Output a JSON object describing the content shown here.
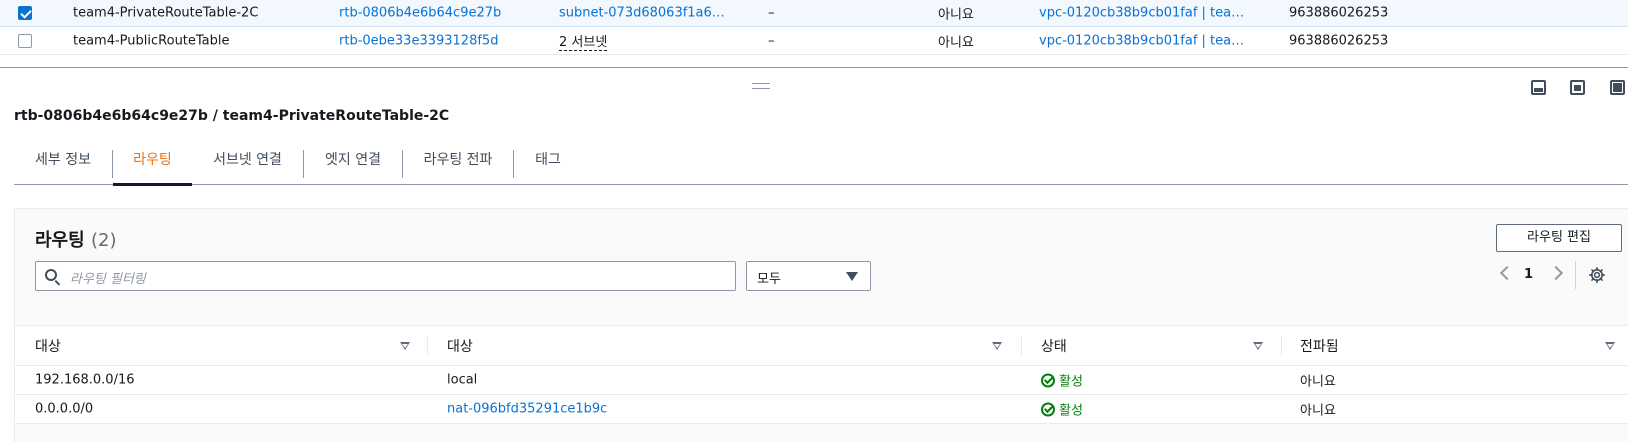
{
  "top_table": {
    "rows": [
      {
        "checked": true,
        "name": "team4-PrivateRouteTable-2C",
        "rtb_id": "rtb-0806b4e6b64c9e27b",
        "subnet": "subnet-073d68063f1a6…",
        "edge": "–",
        "main": "아니요",
        "vpc": "vpc-0120cb38b9cb01faf | tea…",
        "owner": "963886026253"
      },
      {
        "checked": false,
        "name": "team4-PublicRouteTable",
        "rtb_id": "rtb-0ebe33e3393128f5d",
        "subnet": "2 서브넷",
        "edge": "–",
        "main": "아니요",
        "vpc": "vpc-0120cb38b9cb01faf | tea…",
        "owner": "963886026253"
      }
    ]
  },
  "split_panel": {
    "title": "rtb-0806b4e6b64c9e27b / team4-PrivateRouteTable-2C",
    "tabs": [
      {
        "label": "세부 정보",
        "active": false
      },
      {
        "label": "라우팅",
        "active": true
      },
      {
        "label": "서브넷 연결",
        "active": false
      },
      {
        "label": "엣지 연결",
        "active": false
      },
      {
        "label": "라우팅 전파",
        "active": false
      },
      {
        "label": "태그",
        "active": false
      }
    ]
  },
  "routes": {
    "header": "라우팅",
    "count": "(2)",
    "edit_button": "라우팅 편집",
    "filter_placeholder": "라우팅 필터링",
    "filter_select": "모두",
    "page": "1",
    "columns": [
      "대상",
      "대상",
      "상태",
      "전파됨"
    ],
    "rows": [
      {
        "destination": "192.168.0.0/16",
        "target": "local",
        "target_link": false,
        "status": "활성",
        "propagated": "아니요"
      },
      {
        "destination": "0.0.0.0/0",
        "target": "nat-096bfd35291ce1b9c",
        "target_link": true,
        "status": "활성",
        "propagated": "아니요"
      }
    ]
  },
  "colors": {
    "accent": "#0972d3",
    "active_tab": "#ec7211",
    "success": "#037f0c"
  }
}
